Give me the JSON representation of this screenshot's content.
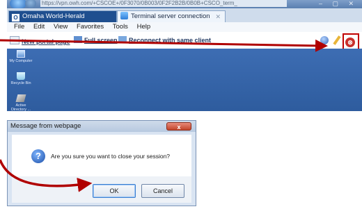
{
  "browser": {
    "url": "https://vpn.owh.com/+CSCOE+/0F3070/0B003/0F2F2B2B/0B0B+CSCO_term_",
    "tabs": [
      {
        "label": "Omaha World-Herald"
      },
      {
        "label": "Terminal server connection"
      }
    ],
    "menu": [
      "File",
      "Edit",
      "View",
      "Favorites",
      "Tools",
      "Help"
    ],
    "toolbar_links": [
      "New portal page",
      "Full screen",
      "Reconnect with same client"
    ],
    "desktop_icons": [
      {
        "label": "My Computer"
      },
      {
        "label": "Recycle Bin"
      },
      {
        "label": "Active Directory ..."
      }
    ]
  },
  "dialog": {
    "title": "Message from webpage",
    "close_glyph": "x",
    "message": "Are you sure you want to close your session?",
    "ok_label": "OK",
    "cancel_label": "Cancel"
  },
  "colors": {
    "annotation_red": "#c00000",
    "desktop_blue": "#2e5c9e",
    "active_tab": "#1f4f8f"
  },
  "icons": [
    "back-icon",
    "forward-icon",
    "question-icon",
    "close-icon",
    "globe-icon",
    "pencil-icon"
  ]
}
